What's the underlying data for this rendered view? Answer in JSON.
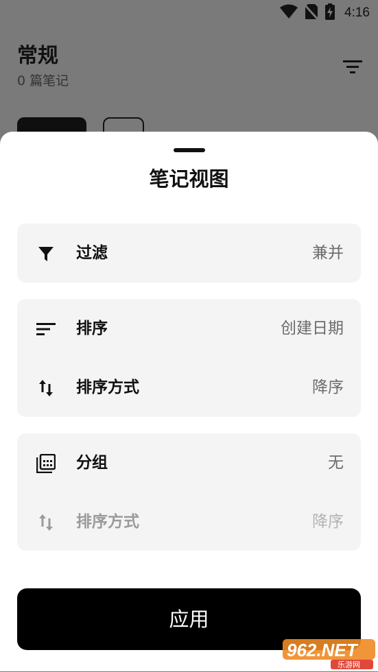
{
  "status_bar": {
    "time": "4:16"
  },
  "background": {
    "title": "常规",
    "subtitle": "0 篇笔记"
  },
  "sheet": {
    "title": "笔记视图",
    "filter": {
      "label": "过滤",
      "value": "兼并"
    },
    "sort": {
      "label": "排序",
      "value": "创建日期"
    },
    "sort_order": {
      "label": "排序方式",
      "value": "降序"
    },
    "group": {
      "label": "分组",
      "value": "无"
    },
    "group_sort_order": {
      "label": "排序方式",
      "value": "降序"
    },
    "apply_label": "应用"
  },
  "watermark": {
    "text": "962.NET",
    "sub": "乐游网"
  },
  "colors": {
    "accent": "#000000",
    "card_bg": "#f4f4f4",
    "scrim": "#7a7a7a"
  }
}
